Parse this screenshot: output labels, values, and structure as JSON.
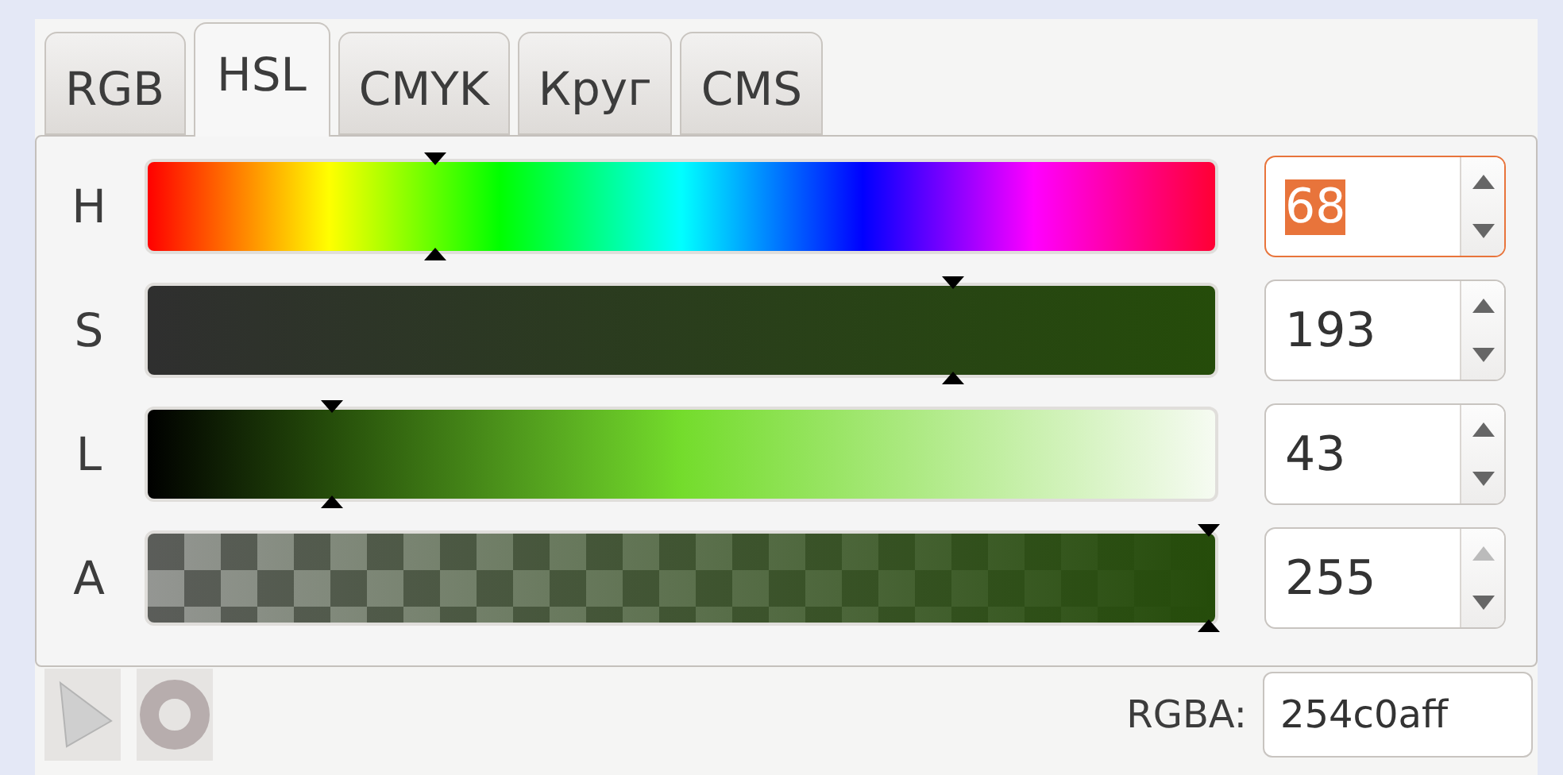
{
  "tabs": [
    {
      "label": "RGB",
      "selected": false
    },
    {
      "label": "HSL",
      "selected": true
    },
    {
      "label": "CMYK",
      "selected": false
    },
    {
      "label": "Круг",
      "selected": false
    },
    {
      "label": "CMS",
      "selected": false
    }
  ],
  "channels": [
    {
      "kind": "hue",
      "label": "H",
      "level": 0.267,
      "value": "68",
      "focused": true
    },
    {
      "kind": "saturation",
      "label": "S",
      "level": 0.757,
      "value": "193",
      "focused": false
    },
    {
      "kind": "lightness",
      "label": "L",
      "level": 0.169,
      "value": "43",
      "focused": false
    },
    {
      "kind": "alpha",
      "label": "A",
      "level": 1,
      "value": "255",
      "focused": false
    }
  ],
  "rgba": {
    "label": "RGBA:",
    "value": "254c0aff"
  }
}
